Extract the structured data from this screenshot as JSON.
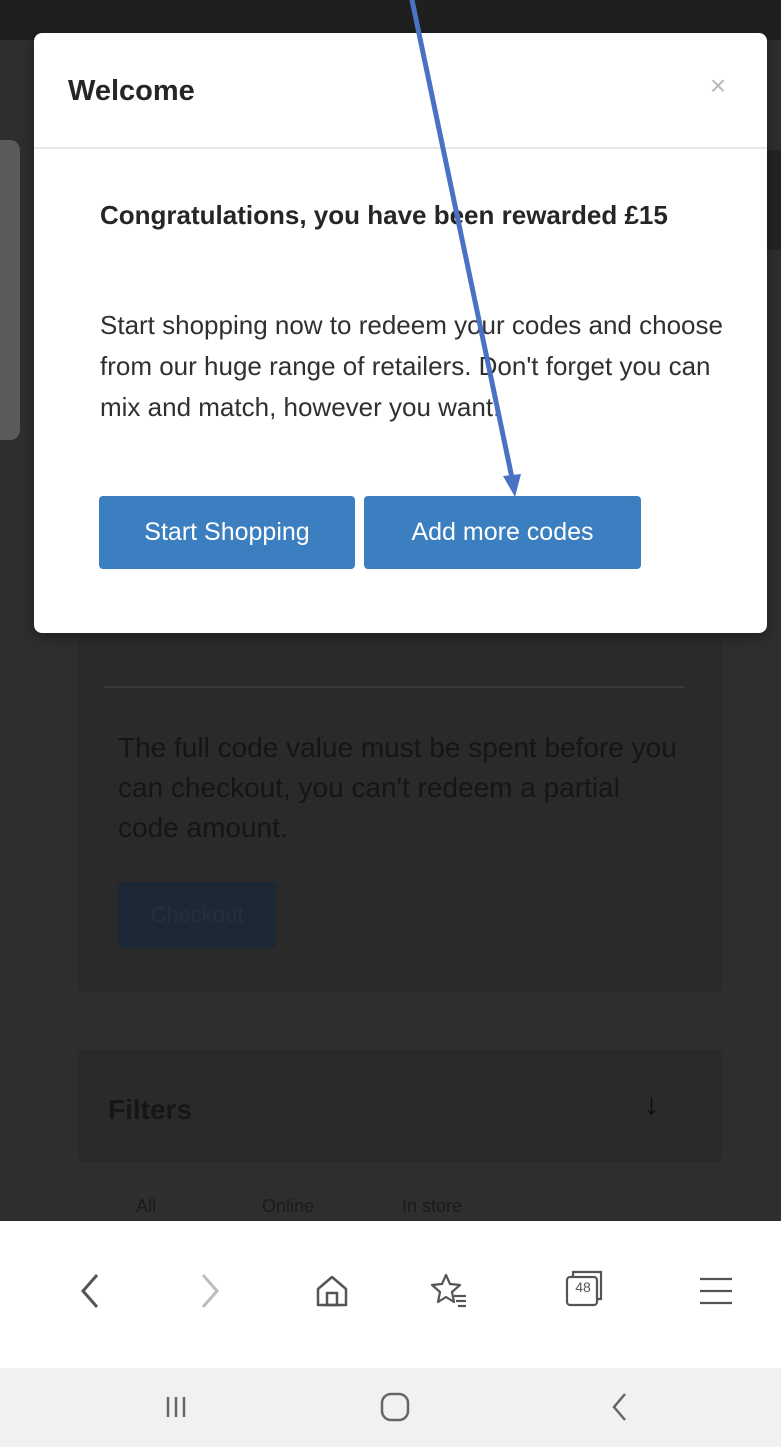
{
  "modal": {
    "title": "Welcome",
    "close_label": "×",
    "heading": "Congratulations, you have been rewarded £15",
    "body": "Start shopping now to redeem your codes and choose from our huge range of retailers. Don't forget you can mix and match, however you want!",
    "start_button": "Start Shopping",
    "add_button": "Add more codes"
  },
  "background": {
    "note": "The full code value must be spent before you can checkout, you can't redeem a partial code amount.",
    "checkout_button": "Checkout",
    "filters_label": "Filters",
    "filters_icon": "arrow-down-icon",
    "filter_tabs": [
      "All",
      "Online",
      "In store"
    ]
  },
  "browser": {
    "tab_count": "48",
    "icons": [
      "back-icon",
      "forward-icon",
      "home-icon",
      "bookmarks-icon",
      "tabs-icon",
      "menu-icon"
    ]
  },
  "system_nav": {
    "icons": [
      "recent-apps-icon",
      "home-icon",
      "back-icon"
    ]
  },
  "colors": {
    "primary_button": "#3b7fc0",
    "overlay": "#2e2e2e",
    "annotation_arrow": "#4a72c4"
  }
}
